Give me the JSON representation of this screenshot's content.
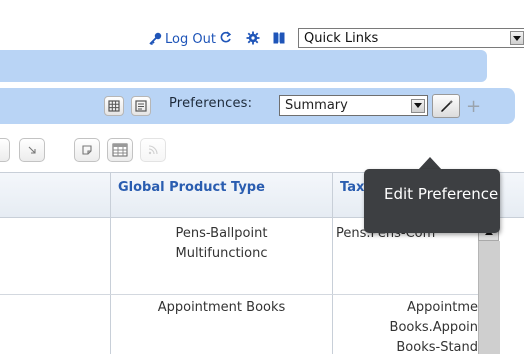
{
  "header": {
    "logout_label": "Log Out",
    "quick_links": {
      "selected": "Quick Links"
    }
  },
  "prefs": {
    "label": "Preferences:",
    "selected": "Summary",
    "add_label": "+"
  },
  "grid": {
    "columns": [
      "Global Product Type",
      "Taxonomy"
    ],
    "rows": [
      {
        "product_type": "Pens-Ballpoint Multifunctionc",
        "taxonomy": "Pens.Pens-Com"
      },
      {
        "product_type": "Appointment Books",
        "taxonomy": "Appointme Books.Appoin Books-Stand"
      }
    ]
  },
  "tooltip": {
    "text": "Edit Preference"
  },
  "colors": {
    "band": "#b9d4f5",
    "header_link": "#1f55b8",
    "tooltip_bg": "#3d3f42"
  },
  "icons": [
    "key-icon",
    "refresh-icon",
    "gear-icon",
    "book-icon",
    "grid-view-icon",
    "list-view-icon",
    "pencil-icon",
    "plus-icon",
    "arrow-down-right-icon",
    "note-icon",
    "table-icon",
    "rss-icon"
  ]
}
